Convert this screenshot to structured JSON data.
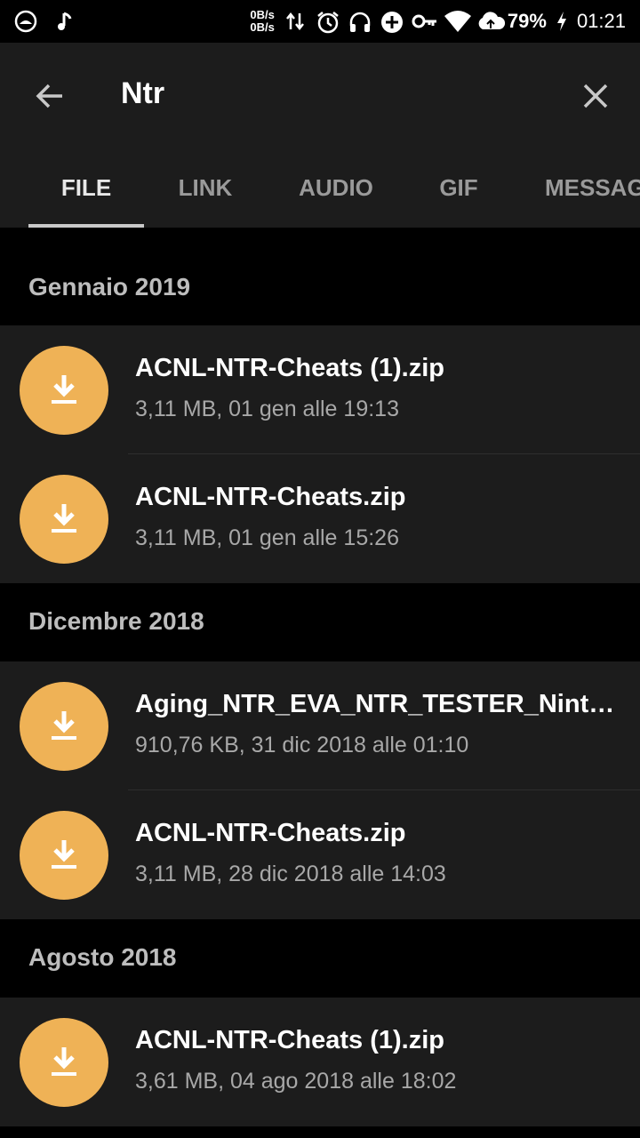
{
  "status_bar": {
    "speed_up": "0B/s",
    "speed_down": "0B/s",
    "battery": "79%",
    "time": "01:21",
    "icons": [
      "app-circle-icon",
      "music-note-icon",
      "data-arrows-icon",
      "alarm-icon",
      "headphones-icon",
      "add-circle-icon",
      "key-icon",
      "wifi-icon",
      "cloud-icon",
      "charging-icon"
    ]
  },
  "header": {
    "search_query": "Ntr",
    "back_icon": "arrow-left-icon",
    "close_icon": "close-icon"
  },
  "tabs": [
    {
      "label": "FILE",
      "active": true
    },
    {
      "label": "LINK",
      "active": false
    },
    {
      "label": "AUDIO",
      "active": false
    },
    {
      "label": "GIF",
      "active": false
    },
    {
      "label": "MESSAGGI VOCALI",
      "active": false
    }
  ],
  "sections": [
    {
      "title": "Gennaio 2019",
      "files": [
        {
          "name": "ACNL-NTR-Cheats (1).zip",
          "meta": "3,11 MB, 01 gen alle 19:13"
        },
        {
          "name": "ACNL-NTR-Cheats.zip",
          "meta": "3,11 MB, 01 gen alle 15:26"
        }
      ]
    },
    {
      "title": "Dicembre 2018",
      "files": [
        {
          "name": "Aging_NTR_EVA_NTR_TESTER_Nintendo.zip",
          "meta": "910,76 KB, 31 dic 2018 alle 01:10"
        },
        {
          "name": "ACNL-NTR-Cheats.zip",
          "meta": "3,11 MB, 28 dic 2018 alle 14:03"
        }
      ]
    },
    {
      "title": "Agosto 2018",
      "files": [
        {
          "name": "ACNL-NTR-Cheats (1).zip",
          "meta": "3,61 MB, 04 ago 2018 alle 18:02"
        }
      ]
    }
  ],
  "colors": {
    "accent_download": "#efb256",
    "header_bg": "#1c1c1c",
    "section_bg": "#000000"
  }
}
